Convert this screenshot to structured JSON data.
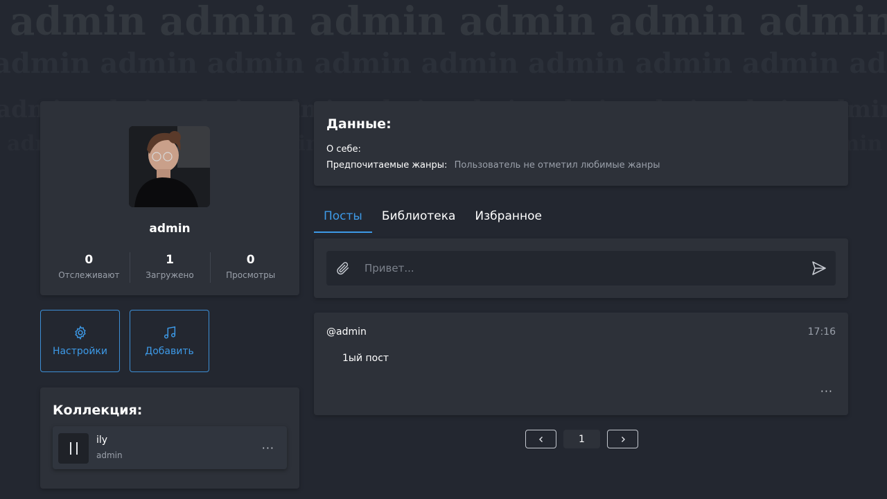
{
  "background_word": "admin",
  "colors": {
    "accent": "#3d9ae8",
    "card": "#2d3139",
    "page": "#232730",
    "muted": "#9aa0aa"
  },
  "profile": {
    "username": "admin",
    "avatar_icon": "user-avatar-photo",
    "stats": [
      {
        "value": "0",
        "label": "Отслеживают"
      },
      {
        "value": "1",
        "label": "Загружено"
      },
      {
        "value": "0",
        "label": "Просмотры"
      }
    ]
  },
  "actions": {
    "settings": {
      "label": "Настройки",
      "icon": "gear-icon"
    },
    "add": {
      "label": "Добавить",
      "icon": "music-note-icon"
    }
  },
  "collection": {
    "title": "Коллекция:",
    "tracks": [
      {
        "title": "ily",
        "artist": "admin",
        "state_icon": "pause-icon",
        "more": "···"
      }
    ]
  },
  "data_panel": {
    "title": "Данные:",
    "about_label": "О себе:",
    "about_value": "",
    "genres_label": "Предпочитаемые жанры:",
    "genres_value": "Пользователь не отметил любимые жанры"
  },
  "tabs": [
    {
      "label": "Посты",
      "active": true
    },
    {
      "label": "Библиотека",
      "active": false
    },
    {
      "label": "Избранное",
      "active": false
    }
  ],
  "compose": {
    "placeholder": "Привет...",
    "attach_icon": "paperclip-icon",
    "send_icon": "send-icon"
  },
  "posts": [
    {
      "author": "@admin",
      "time": "17:16",
      "body": "1ый пост",
      "more": "···"
    }
  ],
  "pagination": {
    "current": "1",
    "prev_icon": "chevron-left-icon",
    "next_icon": "chevron-right-icon"
  }
}
